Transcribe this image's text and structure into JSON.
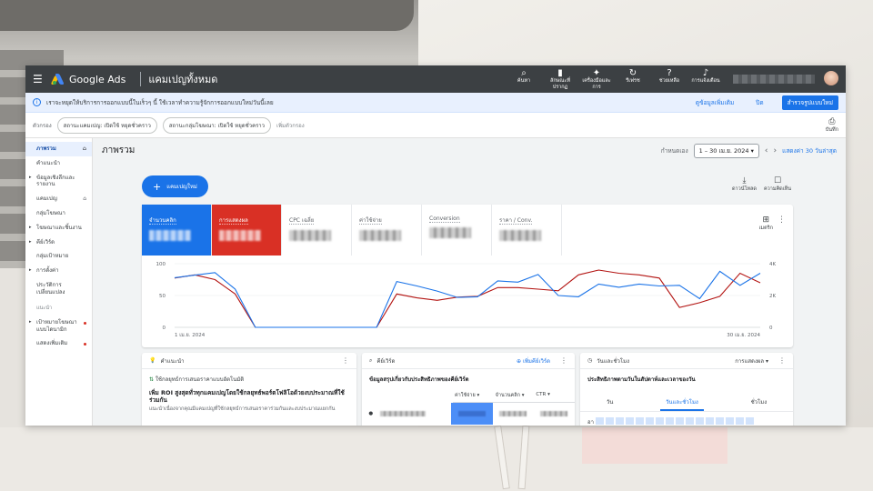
{
  "header": {
    "brand": "Google Ads",
    "breadcrumb": "แคมเปญทั้งหมด",
    "tools": [
      {
        "icon": "search-icon",
        "glyph": "⌕",
        "label": "ค้นหา"
      },
      {
        "icon": "page-icon",
        "glyph": "▮",
        "label": "ลักษณะที่ปรากฏ"
      },
      {
        "icon": "wrench-icon",
        "glyph": "✦",
        "label": "เครื่องมือและ การ"
      },
      {
        "icon": "refresh-icon",
        "glyph": "↻",
        "label": "รีเฟรช"
      },
      {
        "icon": "help-icon",
        "glyph": "?",
        "label": "ช่วยเหลือ"
      },
      {
        "icon": "bell-icon",
        "glyph": "♪",
        "label": "การแจ้งเตือน"
      }
    ]
  },
  "notice": {
    "text": "เราจะหยุดให้บริการการออกแบบนี้ในเร็วๆ นี้ ใช้เวลาทำความรู้จักการออกแบบใหม่วันนี้เลย",
    "learn_more": "ดูข้อมูลเพิ่มเติม",
    "dismiss": "ปิด",
    "try_new": "สำรวจรูปแบบใหม่"
  },
  "filters": {
    "label": "ตัวกรอง",
    "chips": [
      "สถานะแคมเปญ: เปิดใช้ หยุดชั่วคราว",
      "สถานะกลุ่มโฆษณา: เปิดใช้ หยุดชั่วคราว"
    ],
    "add": "เพิ่มตัวกรอง",
    "export": "บันทึก"
  },
  "sidebar": {
    "items": [
      {
        "label": "ภาพรวม",
        "active": true,
        "home": true
      },
      {
        "label": "คำแนะนำ"
      },
      {
        "label": "ข้อมูลเชิงลึกและรายงาน",
        "caret": true
      },
      {
        "label": "แคมเปญ",
        "home": true
      },
      {
        "label": "กลุ่มโฆษณา"
      },
      {
        "label": "โฆษณาและชิ้นงาน",
        "caret": true
      },
      {
        "label": "คีย์เวิร์ด",
        "caret": true
      },
      {
        "label": "กลุ่มเป้าหมาย"
      },
      {
        "label": "การตั้งค่า",
        "caret": true
      },
      {
        "label": "ประวัติการเปลี่ยนแปลง"
      },
      {
        "label": "แนะนำ",
        "small": true
      },
      {
        "label": "เป้าหมายโฆษณาแบบไดนามิก",
        "dot": true,
        "caret": true
      },
      {
        "label": "แสดงเพิ่มเติม",
        "dot": true
      }
    ]
  },
  "overview": {
    "title": "ภาพรวม",
    "custom_label": "กำหนดเอง",
    "date_range": "1 – 30 เม.ย. 2024",
    "compare": "แสดงค่า 30 วันล่าสุด",
    "new_campaign": "แคมเปญใหม่",
    "download": "ดาวน์โหลด",
    "feedback": "ความคิดเห็น"
  },
  "metrics": [
    {
      "label": "จำนวนคลิก",
      "color": "#1a73e8"
    },
    {
      "label": "การแสดงผล",
      "color": "#d93025"
    },
    {
      "label": "CPC เฉลี่ย"
    },
    {
      "label": "ค่าใช้จ่าย"
    },
    {
      "label": "Conversion"
    },
    {
      "label": "ราคา / Conv."
    }
  ],
  "metrics_menu": "เมตริก",
  "chart_data": {
    "type": "line",
    "x_start_label": "1 เม.ย. 2024",
    "x_end_label": "30 เม.ย. 2024",
    "left_ticks": [
      "100",
      "50",
      "0"
    ],
    "right_ticks": [
      "4K",
      "2K",
      "0"
    ],
    "ylim_left": [
      0,
      100
    ],
    "ylim_right": [
      0,
      4000
    ],
    "days": [
      1,
      2,
      3,
      4,
      5,
      6,
      7,
      8,
      9,
      10,
      11,
      12,
      13,
      14,
      15,
      16,
      17,
      18,
      19,
      20,
      21,
      22,
      23,
      24,
      25,
      26,
      27,
      28,
      29,
      30
    ],
    "series": [
      {
        "color": "#1a73e8",
        "axis": "left",
        "values": [
          78,
          82,
          86,
          60,
          0,
          0,
          0,
          0,
          0,
          0,
          0,
          72,
          65,
          57,
          47,
          48,
          73,
          71,
          83,
          50,
          48,
          68,
          63,
          68,
          65,
          66,
          45,
          88,
          66,
          85
        ]
      },
      {
        "color": "#b31412",
        "axis": "right",
        "values": [
          3100,
          3300,
          3000,
          2100,
          0,
          0,
          0,
          0,
          0,
          0,
          0,
          2100,
          1850,
          1700,
          1900,
          1950,
          2500,
          2500,
          2400,
          2300,
          3300,
          3600,
          3400,
          3300,
          3100,
          1250,
          1550,
          1950,
          3400,
          2800
        ]
      }
    ]
  },
  "cards": {
    "recommendations": {
      "title": "คำแนะนำ",
      "item": "ใช้กลยุทธ์การเสนอราคาแบบอัตโนมัติ",
      "headline": "เพิ่ม ROI สูงสุดทั่วทุกแคมเปญโดยใช้กลยุทธ์พอร์ตโฟลิโอด้วยงบประมาณที่ใช้ร่วมกัน",
      "desc": "แนะนำเนื่องจากคุณมีแคมเปญที่ใช้กลยุทธ์การเสนอราคาร่วมกันและงบประมาณแยกกัน"
    },
    "keywords": {
      "title": "คีย์เวิร์ด",
      "add": "เพิ่มคีย์เวิร์ด",
      "subtitle": "ข้อมูลสรุปเกี่ยวกับประสิทธิภาพของคีย์เวิร์ด",
      "columns": [
        "ค่าใช้จ่าย",
        "จำนวนคลิก",
        "CTR"
      ]
    },
    "daytime": {
      "title": "วันและชั่วโมง",
      "metric": "การแสดงผล",
      "subtitle": "ประสิทธิภาพตามวันในสัปดาห์และเวลาของวัน",
      "tabs": [
        "วัน",
        "วันและชั่วโมง",
        "ชั่วโมง"
      ],
      "row_label": "อา"
    }
  }
}
